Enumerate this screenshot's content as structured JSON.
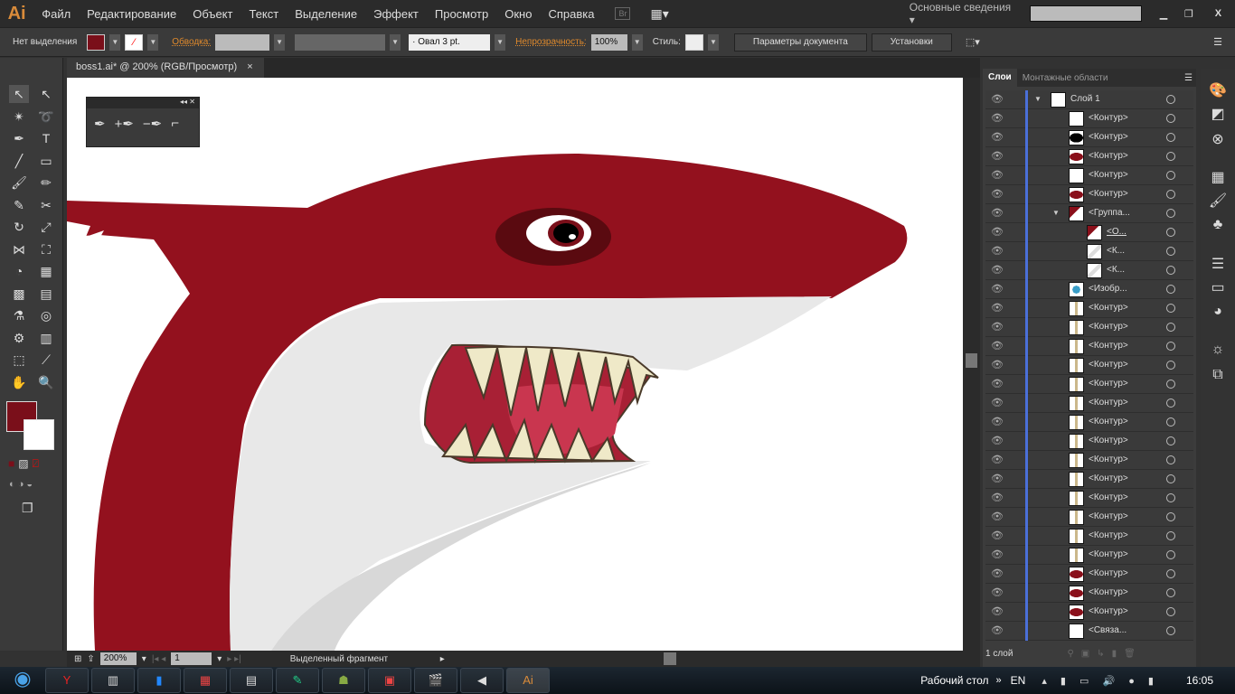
{
  "app": {
    "logo": "Ai",
    "menu": [
      "Файл",
      "Редактирование",
      "Объект",
      "Текст",
      "Выделение",
      "Эффект",
      "Просмотр",
      "Окно",
      "Справка"
    ],
    "bridge": "Br",
    "workspace": "Основные сведения",
    "search_placeholder": ""
  },
  "control": {
    "selection": "Нет выделения",
    "fill_color": "#7a0f1a",
    "stroke_label": "Обводка:",
    "brush": "Овал 3 pt.",
    "opacity_label": "Непрозрачность:",
    "opacity": "100%",
    "style_label": "Стиль:",
    "doc_settings": "Параметры документа",
    "preferences": "Установки"
  },
  "document": {
    "tab": "boss1.ai* @ 200% (RGB/Просмотр)",
    "close": "×"
  },
  "status": {
    "zoom": "200%",
    "artboard": "1",
    "info": "Выделенный фрагмент"
  },
  "layers": {
    "tabs": [
      "Слои",
      "Монтажные области"
    ],
    "count": "1 слой",
    "rows": [
      {
        "name": "Слой 1",
        "level": 0,
        "expand": true,
        "thumb": "layer"
      },
      {
        "name": "<Контур>",
        "level": 1,
        "thumb": "white"
      },
      {
        "name": "<Контур>",
        "level": 1,
        "thumb": "black"
      },
      {
        "name": "<Контур>",
        "level": 1,
        "thumb": "red"
      },
      {
        "name": "<Контур>",
        "level": 1,
        "thumb": "white"
      },
      {
        "name": "<Контур>",
        "level": 1,
        "thumb": "red"
      },
      {
        "name": "<Группа...",
        "level": 1,
        "expand": true,
        "thumb": "fin"
      },
      {
        "name": "<О...",
        "level": 2,
        "thumb": "fin"
      },
      {
        "name": "<К...",
        "level": 2,
        "thumb": "grey"
      },
      {
        "name": "<К...",
        "level": 2,
        "thumb": "grey"
      },
      {
        "name": "<Изобр...",
        "level": 1,
        "thumb": "image"
      },
      {
        "name": "<Контур>",
        "level": 1,
        "thumb": "tooth"
      },
      {
        "name": "<Контур>",
        "level": 1,
        "thumb": "tooth"
      },
      {
        "name": "<Контур>",
        "level": 1,
        "thumb": "tooth"
      },
      {
        "name": "<Контур>",
        "level": 1,
        "thumb": "tooth"
      },
      {
        "name": "<Контур>",
        "level": 1,
        "thumb": "tooth"
      },
      {
        "name": "<Контур>",
        "level": 1,
        "thumb": "tooth"
      },
      {
        "name": "<Контур>",
        "level": 1,
        "thumb": "tooth"
      },
      {
        "name": "<Контур>",
        "level": 1,
        "thumb": "tooth"
      },
      {
        "name": "<Контур>",
        "level": 1,
        "thumb": "tooth"
      },
      {
        "name": "<Контур>",
        "level": 1,
        "thumb": "tooth"
      },
      {
        "name": "<Контур>",
        "level": 1,
        "thumb": "tooth"
      },
      {
        "name": "<Контур>",
        "level": 1,
        "thumb": "tooth"
      },
      {
        "name": "<Контур>",
        "level": 1,
        "thumb": "tooth"
      },
      {
        "name": "<Контур>",
        "level": 1,
        "thumb": "tooth"
      },
      {
        "name": "<Контур>",
        "level": 1,
        "thumb": "red"
      },
      {
        "name": "<Контур>",
        "level": 1,
        "thumb": "red"
      },
      {
        "name": "<Контур>",
        "level": 1,
        "thumb": "red"
      },
      {
        "name": "<Связа...",
        "level": 1,
        "thumb": "link"
      }
    ]
  },
  "taskbar": {
    "desktop": "Рабочий стол",
    "lang": "EN",
    "time": "16:05"
  },
  "colors": {
    "shark_red": "#93111e",
    "belly": "#e8e8e8",
    "accent": "#4a6fd8"
  }
}
